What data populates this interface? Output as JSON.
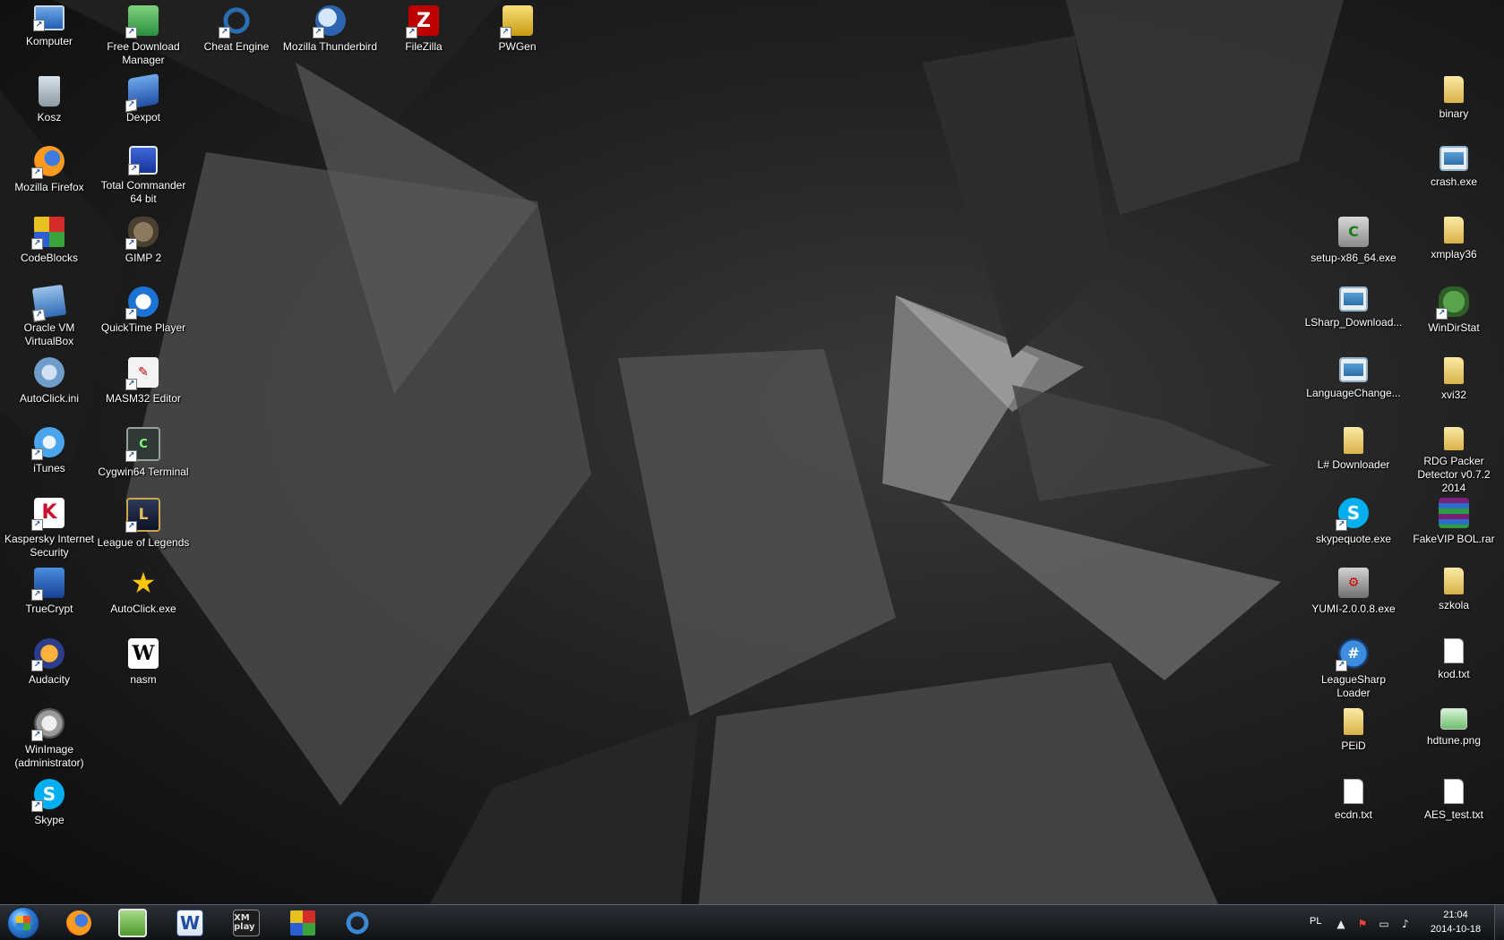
{
  "desktop": {
    "left_column_1": [
      {
        "label": "Komputer",
        "icon": "computer-icon"
      },
      {
        "label": "Kosz",
        "icon": "recycle-bin-icon"
      },
      {
        "label": "Mozilla Firefox",
        "icon": "firefox-icon"
      },
      {
        "label": "CodeBlocks",
        "icon": "codeblocks-icon"
      },
      {
        "label": "Oracle VM VirtualBox",
        "icon": "virtualbox-icon"
      },
      {
        "label": "AutoClick.ini",
        "icon": "settings-file-icon"
      },
      {
        "label": "iTunes",
        "icon": "itunes-icon"
      },
      {
        "label": "Kaspersky Internet Security",
        "icon": "kaspersky-icon"
      },
      {
        "label": "TrueCrypt",
        "icon": "truecrypt-icon"
      },
      {
        "label": "Audacity",
        "icon": "audacity-icon"
      },
      {
        "label": "WinImage (administrator)",
        "icon": "winimage-icon"
      },
      {
        "label": "Skype",
        "icon": "skype-icon"
      }
    ],
    "left_column_2": [
      {
        "label": "Free Download Manager",
        "icon": "download-manager-icon"
      },
      {
        "label": "Dexpot",
        "icon": "dexpot-icon"
      },
      {
        "label": "Total Commander 64 bit",
        "icon": "total-commander-icon"
      },
      {
        "label": "GIMP 2",
        "icon": "gimp-icon"
      },
      {
        "label": "QuickTime Player",
        "icon": "quicktime-icon"
      },
      {
        "label": "MASM32 Editor",
        "icon": "masm32-icon"
      },
      {
        "label": "Cygwin64 Terminal",
        "icon": "cygwin-terminal-icon"
      },
      {
        "label": "League of Legends",
        "icon": "league-of-legends-icon"
      },
      {
        "label": "AutoClick.exe",
        "icon": "star-icon"
      },
      {
        "label": "nasm",
        "icon": "nasm-icon"
      }
    ],
    "top_row": [
      {
        "label": "Cheat Engine",
        "icon": "cheat-engine-icon"
      },
      {
        "label": "Mozilla Thunderbird",
        "icon": "thunderbird-icon"
      },
      {
        "label": "FileZilla",
        "icon": "filezilla-icon"
      },
      {
        "label": "PWGen",
        "icon": "pwgen-icon"
      }
    ],
    "right_column_1": [
      {
        "label": "setup-x86_64.exe",
        "icon": "setup-icon"
      },
      {
        "label": "LSharp_Download...",
        "icon": "exe-window-icon"
      },
      {
        "label": "LanguageChange...",
        "icon": "exe-window-icon"
      },
      {
        "label": "L# Downloader",
        "icon": "folder-icon"
      },
      {
        "label": "skypequote.exe",
        "icon": "skype-icon"
      },
      {
        "label": "YUMI-2.0.0.8.exe",
        "icon": "yumi-icon"
      },
      {
        "label": "LeagueSharp Loader",
        "icon": "leaguesharp-icon"
      },
      {
        "label": "PEiD",
        "icon": "folder-icon"
      },
      {
        "label": "ecdn.txt",
        "icon": "text-file-icon"
      }
    ],
    "right_column_2": [
      {
        "label": "binary",
        "icon": "folder-icon"
      },
      {
        "label": "crash.exe",
        "icon": "exe-window-icon"
      },
      {
        "label": "xmplay36",
        "icon": "folder-icon"
      },
      {
        "label": "WinDirStat",
        "icon": "windirstat-icon"
      },
      {
        "label": "xvi32",
        "icon": "folder-icon"
      },
      {
        "label": "RDG Packer Detector v0.7.2 2014",
        "icon": "folder-icon"
      },
      {
        "label": "FakeVIP BOL.rar",
        "icon": "rar-archive-icon"
      },
      {
        "label": "szkola",
        "icon": "folder-icon"
      },
      {
        "label": "kod.txt",
        "icon": "text-file-icon"
      },
      {
        "label": "hdtune.png",
        "icon": "image-file-icon"
      },
      {
        "label": "AES_test.txt",
        "icon": "text-file-icon"
      }
    ]
  },
  "taskbar": {
    "pinned": [
      {
        "name": "firefox",
        "icon": "firefox-icon"
      },
      {
        "name": "notepad++",
        "icon": "notepad-plus-icon"
      },
      {
        "name": "word",
        "icon": "word-icon",
        "glyph": "W"
      },
      {
        "name": "xmplay",
        "icon": "xmplay-icon",
        "glyph": "XM play"
      },
      {
        "name": "codeblocks",
        "icon": "codeblocks-icon"
      },
      {
        "name": "cheat-engine",
        "icon": "cheat-engine-icon"
      }
    ],
    "language": "PL",
    "clock": {
      "time": "21:04",
      "date": "2014-10-18"
    }
  }
}
